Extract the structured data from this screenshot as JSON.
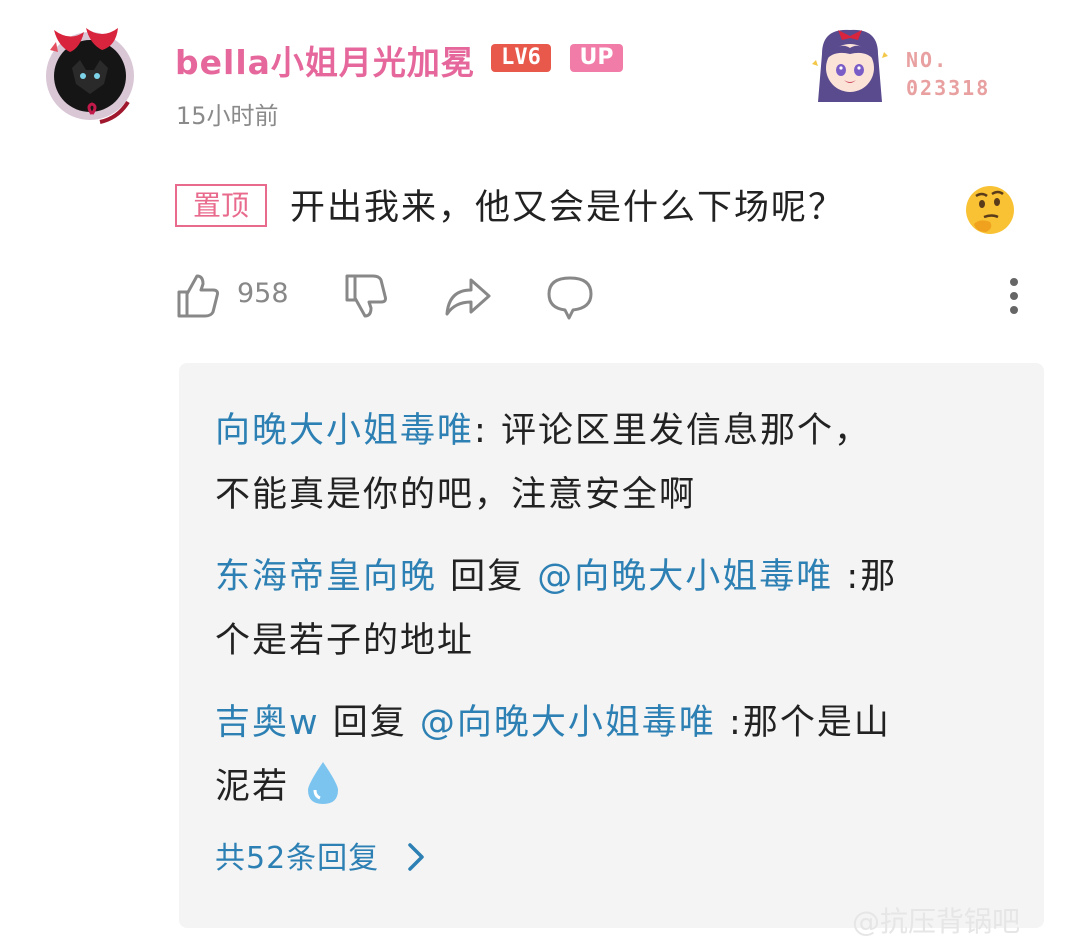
{
  "post": {
    "username": "bella小姐月光加冕",
    "level_badge": "LV6",
    "up_badge": "UP",
    "timestamp": "15小时前",
    "fan_number_label": "NO.",
    "fan_number": "023318",
    "pin_tag": "置顶",
    "comment_text": "开出我来，他又会是什么下场呢？",
    "emoji": "thinking-face-emoji",
    "like_count": "958"
  },
  "icons": {
    "like": "thumbs-up-icon",
    "dislike": "thumbs-down-icon",
    "share": "share-arrow-icon",
    "comment": "speech-bubble-icon",
    "more": "vertical-dots-icon",
    "chevron": "chevron-right-icon",
    "water_drop": "water-drop-emoji"
  },
  "replies": [
    {
      "author": "向晚大小姐毒唯",
      "separator": ": ",
      "line1": "评论区里发信息那个，",
      "line2": "不能真是你的吧，注意安全啊"
    },
    {
      "author": "东海帝皇向晚",
      "reply_word": " 回复 ",
      "mention": "@向晚大小姐毒唯",
      "line1": " :那",
      "line2": "个是若子的地址"
    },
    {
      "author": "吉奥w",
      "reply_word": " 回复 ",
      "mention": "@向晚大小姐毒唯",
      "line1": " :那个是山",
      "line2": "泥若"
    }
  ],
  "more_replies_label": "共52条回复",
  "watermark": "@抗压背锅吧",
  "colors": {
    "username": "#e5679b",
    "level_badge": "#e8584b",
    "up_badge": "#f07ca7",
    "pin_tag": "#e86a8c",
    "link_blue": "#2d80b3",
    "reply_bg": "#f4f4f4"
  }
}
